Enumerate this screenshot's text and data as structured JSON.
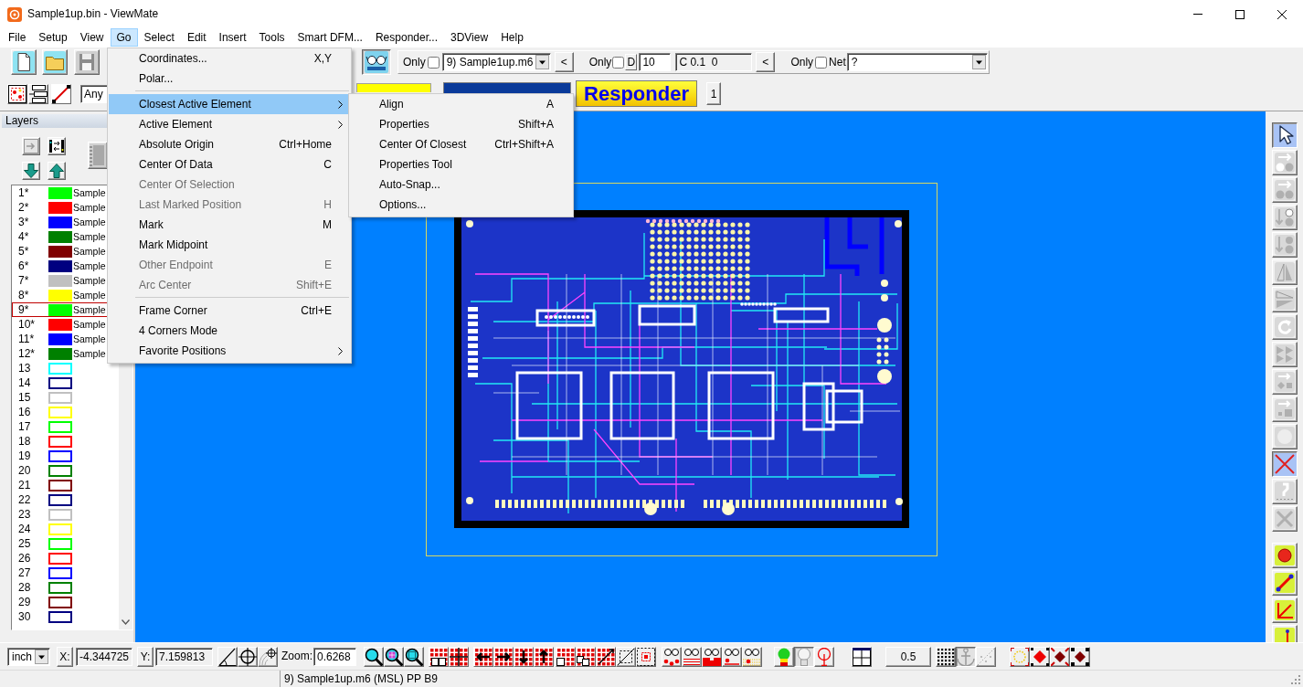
{
  "window": {
    "title": "Sample1up.bin - ViewMate"
  },
  "menu_bar": [
    {
      "label": "File",
      "selected": false
    },
    {
      "label": "Setup",
      "selected": false
    },
    {
      "label": "View",
      "selected": false
    },
    {
      "label": "Go",
      "selected": true
    },
    {
      "label": "Select",
      "selected": false
    },
    {
      "label": "Edit",
      "selected": false
    },
    {
      "label": "Insert",
      "selected": false
    },
    {
      "label": "Tools",
      "selected": false
    },
    {
      "label": "Smart DFM...",
      "selected": false
    },
    {
      "label": "Responder...",
      "selected": false
    },
    {
      "label": "3DView",
      "selected": false
    },
    {
      "label": "Help",
      "selected": false
    }
  ],
  "main_toolbar": {
    "buttons": [
      {
        "pressed": false
      },
      {
        "pressed": false
      },
      {
        "pressed": false
      },
      {
        "pressed": true
      }
    ],
    "layer_filter": {
      "only_label": "Only",
      "only_checked": false,
      "value": "9) Sample1up.m6",
      "back_button": "<"
    },
    "dcode_filter": {
      "only_label": "Only",
      "only_checked": false,
      "d_label": "D",
      "d_value": "10",
      "code_value": "C 0.1  0",
      "back_button": "<"
    },
    "net_filter": {
      "only_label": "Only",
      "only_checked": false,
      "net_label": "Net",
      "value": "?"
    }
  },
  "second_toolbar": {
    "type_filter": "Any",
    "responder_button": "Responder",
    "page_button": "1"
  },
  "layers_panel": {
    "title": "Layers",
    "layers": [
      {
        "number": "1*",
        "color": "#00ff00",
        "filled": true,
        "name": "Sample",
        "selected": false
      },
      {
        "number": "2*",
        "color": "#ff0000",
        "filled": true,
        "name": "Sample",
        "selected": false
      },
      {
        "number": "3*",
        "color": "#0000ff",
        "filled": true,
        "name": "Sample",
        "selected": false
      },
      {
        "number": "4*",
        "color": "#008000",
        "filled": true,
        "name": "Sample",
        "selected": false
      },
      {
        "number": "5*",
        "color": "#800000",
        "filled": true,
        "name": "Sample",
        "selected": false
      },
      {
        "number": "6*",
        "color": "#000080",
        "filled": true,
        "name": "Sample",
        "selected": false
      },
      {
        "number": "7*",
        "color": "#c0c0c0",
        "filled": true,
        "name": "Sample",
        "selected": false
      },
      {
        "number": "8*",
        "color": "#ffff00",
        "filled": true,
        "name": "Sample",
        "selected": false
      },
      {
        "number": "9*",
        "color": "#00ff00",
        "filled": true,
        "name": "Sample",
        "selected": true
      },
      {
        "number": "10*",
        "color": "#ff0000",
        "filled": true,
        "name": "Sample",
        "selected": false
      },
      {
        "number": "11*",
        "color": "#0000ff",
        "filled": true,
        "name": "Sample",
        "selected": false
      },
      {
        "number": "12*",
        "color": "#008000",
        "filled": true,
        "name": "Sample",
        "selected": false
      },
      {
        "number": "13",
        "color": "#00ffff",
        "filled": false,
        "selected": false
      },
      {
        "number": "14",
        "color": "#000080",
        "filled": false,
        "selected": false
      },
      {
        "number": "15",
        "color": "#c0c0c0",
        "filled": false,
        "selected": false
      },
      {
        "number": "16",
        "color": "#ffff00",
        "filled": false,
        "selected": false
      },
      {
        "number": "17",
        "color": "#00ff00",
        "filled": false,
        "selected": false
      },
      {
        "number": "18",
        "color": "#ff0000",
        "filled": false,
        "selected": false
      },
      {
        "number": "19",
        "color": "#0000ff",
        "filled": false,
        "selected": false
      },
      {
        "number": "20",
        "color": "#008000",
        "filled": false,
        "selected": false
      },
      {
        "number": "21",
        "color": "#800000",
        "filled": false,
        "selected": false
      },
      {
        "number": "22",
        "color": "#000080",
        "filled": false,
        "selected": false
      },
      {
        "number": "23",
        "color": "#c0c0c0",
        "filled": false,
        "selected": false
      },
      {
        "number": "24",
        "color": "#ffff00",
        "filled": false,
        "selected": false
      },
      {
        "number": "25",
        "color": "#00ff00",
        "filled": false,
        "selected": false
      },
      {
        "number": "26",
        "color": "#ff0000",
        "filled": false,
        "selected": false
      },
      {
        "number": "27",
        "color": "#0000ff",
        "filled": false,
        "selected": false
      },
      {
        "number": "28",
        "color": "#008000",
        "filled": false,
        "selected": false
      },
      {
        "number": "29",
        "color": "#800000",
        "filled": false,
        "selected": false
      },
      {
        "number": "30",
        "color": "#000080",
        "filled": false,
        "selected": false
      }
    ]
  },
  "go_menu": {
    "items": [
      {
        "kind": "item",
        "label": "Coordinates...",
        "shortcut": "X,Y",
        "submenu": false,
        "disabled": false,
        "selected": false
      },
      {
        "kind": "item",
        "label": "Polar...",
        "submenu": false,
        "disabled": false,
        "selected": false
      },
      {
        "kind": "separator"
      },
      {
        "kind": "item",
        "label": "Closest Active Element",
        "submenu": true,
        "disabled": false,
        "selected": true
      },
      {
        "kind": "item",
        "label": "Active Element",
        "submenu": true,
        "disabled": false,
        "selected": false
      },
      {
        "kind": "item",
        "label": "Absolute Origin",
        "shortcut": "Ctrl+Home",
        "submenu": false,
        "disabled": false,
        "selected": false
      },
      {
        "kind": "item",
        "label": "Center Of Data",
        "shortcut": "C",
        "submenu": false,
        "disabled": false,
        "selected": false
      },
      {
        "kind": "item",
        "label": "Center Of Selection",
        "submenu": false,
        "disabled": true,
        "selected": false
      },
      {
        "kind": "item",
        "label": "Last Marked Position",
        "shortcut": "H",
        "submenu": false,
        "disabled": true,
        "selected": false
      },
      {
        "kind": "item",
        "label": "Mark",
        "shortcut": "M",
        "submenu": false,
        "disabled": false,
        "selected": false
      },
      {
        "kind": "item",
        "label": "Mark Midpoint",
        "submenu": false,
        "disabled": false,
        "selected": false
      },
      {
        "kind": "item",
        "label": "Other Endpoint",
        "shortcut": "E",
        "submenu": false,
        "disabled": true,
        "selected": false
      },
      {
        "kind": "item",
        "label": "Arc Center",
        "shortcut": "Shift+E",
        "submenu": false,
        "disabled": true,
        "selected": false
      },
      {
        "kind": "separator"
      },
      {
        "kind": "item",
        "label": "Frame Corner",
        "shortcut": "Ctrl+E",
        "submenu": false,
        "disabled": false,
        "selected": false
      },
      {
        "kind": "item",
        "label": "4 Corners Mode",
        "submenu": false,
        "disabled": false,
        "selected": false
      },
      {
        "kind": "item",
        "label": "Favorite Positions",
        "submenu": true,
        "disabled": false,
        "selected": false
      }
    ]
  },
  "closest_submenu": {
    "items": [
      {
        "label": "Align",
        "shortcut": "A",
        "selected": false
      },
      {
        "label": "Properties",
        "shortcut": "Shift+A",
        "selected": false
      },
      {
        "label": "Center Of Closest",
        "shortcut": "Ctrl+Shift+A",
        "selected": false
      },
      {
        "label": "Properties Tool",
        "selected": false
      },
      {
        "label": "Auto-Snap...",
        "selected": false
      },
      {
        "label": "Options...",
        "selected": false
      }
    ]
  },
  "right_toolbar": {
    "buttons": [
      {
        "pressed": true
      },
      {
        "pressed": false
      },
      {
        "pressed": false
      },
      {
        "pressed": false
      },
      {
        "pressed": false
      },
      {
        "pressed": false
      },
      {
        "pressed": false
      },
      {
        "pressed": false
      },
      {
        "pressed": false
      },
      {
        "pressed": false
      },
      {
        "pressed": false
      },
      {
        "pressed": false
      },
      {
        "pressed": true
      },
      {
        "pressed": false
      },
      {
        "pressed": false
      },
      {
        "pressed": false
      },
      {
        "pressed": false
      },
      {
        "pressed": false
      },
      {
        "pressed": false
      }
    ]
  },
  "bottom_toolbar": {
    "units": "inch",
    "x_label": "X:",
    "x_value": "-4.344725",
    "y_label": "Y:",
    "y_value": "7.159813",
    "zoom_label": "Zoom:",
    "zoom_value": "0.6268",
    "snap_value": "0.5",
    "buttons": [
      {
        "pressed": false
      },
      {
        "pressed": false
      },
      {
        "pressed": false
      },
      {
        "pressed": false
      },
      {
        "pressed": false
      },
      {
        "pressed": false
      },
      {
        "pressed": false
      },
      {
        "pressed": false
      },
      {
        "pressed": false
      },
      {
        "pressed": false
      },
      {
        "pressed": false
      },
      {
        "pressed": false
      },
      {
        "pressed": false
      },
      {
        "pressed": false
      },
      {
        "pressed": false
      },
      {
        "pressed": false
      },
      {
        "pressed": false
      },
      {
        "pressed": false
      },
      {
        "pressed": false
      },
      {
        "pressed": false
      },
      {
        "pressed": false
      },
      {
        "pressed": false
      },
      {
        "pressed": false
      },
      {
        "pressed": true
      },
      {
        "pressed": false
      },
      {
        "pressed": false
      },
      {
        "pressed": false
      },
      {
        "pressed": true
      },
      {
        "pressed": false
      },
      {
        "pressed": false
      },
      {
        "pressed": false
      },
      {
        "pressed": false
      },
      {
        "pressed": false
      }
    ]
  },
  "status_bar": {
    "text": "9) Sample1up.m6 (MSL) PP B9"
  }
}
